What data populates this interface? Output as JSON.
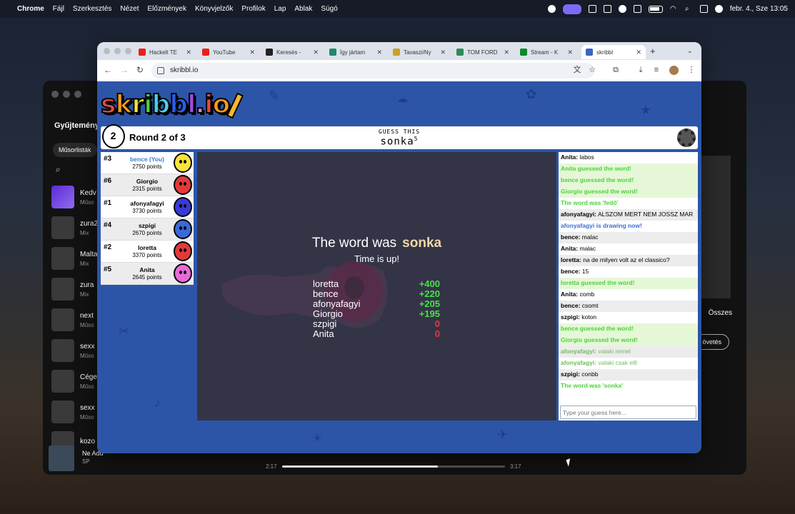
{
  "menubar": {
    "app": "Chrome",
    "items": [
      "Fájl",
      "Szerkesztés",
      "Nézet",
      "Előzmények",
      "Könyvjelzők",
      "Profilok",
      "Lap",
      "Ablak",
      "Súgó"
    ],
    "datetime": "febr. 4., Sze  13:05"
  },
  "spotify": {
    "section": "Gyűjtemény",
    "filter": "Műsorlisták",
    "rows": [
      {
        "title": "Kedv",
        "sub": "Műso"
      },
      {
        "title": "zura2",
        "sub": "Mix"
      },
      {
        "title": "Malta",
        "sub": "Mix"
      },
      {
        "title": "zura",
        "sub": "Mix"
      },
      {
        "title": "next",
        "sub": "Műso"
      },
      {
        "title": "sexx",
        "sub": "Műso"
      },
      {
        "title": "Céget",
        "sub": "Műso"
      },
      {
        "title": "sexx",
        "sub": "Műso"
      },
      {
        "title": "kozo",
        "sub": ""
      }
    ],
    "all_label": "Összes",
    "follow_label": "övetés",
    "player": {
      "song": "Ne Add",
      "artist": "SP",
      "elapsed": "2:17",
      "total": "3:17",
      "progress": 0.7
    }
  },
  "chrome": {
    "tabs": [
      {
        "label": "Hackelt TE",
        "color": "#e62117"
      },
      {
        "label": "YouTube",
        "color": "#e62117"
      },
      {
        "label": "Keresés -",
        "color": "#222"
      },
      {
        "label": "Így jártam",
        "color": "#1e8a6b"
      },
      {
        "label": "Tavaszi/Ny",
        "color": "#c9a227"
      },
      {
        "label": "TOM FORD",
        "color": "#2e8b57"
      },
      {
        "label": "Stream - K",
        "color": "#0b8a2a"
      },
      {
        "label": "skribbl",
        "color": "#3b63c4"
      }
    ],
    "url": "skribbl.io"
  },
  "game": {
    "logo": [
      "s",
      "k",
      "r",
      "i",
      "b",
      "b",
      "l",
      ".",
      "i",
      "o",
      ""
    ],
    "round_num": "2",
    "round_text": "Round 2 of 3",
    "guess_label": "GUESS THIS",
    "word": "sonka",
    "word_len": "5",
    "players": [
      {
        "rank": "#3",
        "name": "bence (You)",
        "points": "2750 points",
        "color": "#f5e43a",
        "you": true
      },
      {
        "rank": "#6",
        "name": "Giorgio",
        "points": "2315 points",
        "color": "#e23a3a",
        "you": false
      },
      {
        "rank": "#1",
        "name": "afonyafagyi",
        "points": "3730 points",
        "color": "#3a3ad8",
        "you": false
      },
      {
        "rank": "#4",
        "name": "szpigi",
        "points": "2670 points",
        "color": "#3a6ad8",
        "you": false
      },
      {
        "rank": "#2",
        "name": "loretta",
        "points": "3370 points",
        "color": "#e23a3a",
        "you": false
      },
      {
        "rank": "#5",
        "name": "Anita",
        "points": "2645 points",
        "color": "#e86ad8",
        "you": false
      }
    ],
    "reveal_prefix": "The word was",
    "reveal_word": "sonka",
    "time_up": "Time is up!",
    "results": [
      {
        "name": "loretta",
        "score": "+400"
      },
      {
        "name": "bence",
        "score": "+220"
      },
      {
        "name": "afonyafagyi",
        "score": "+205"
      },
      {
        "name": "Giorgio",
        "score": "+195"
      },
      {
        "name": "szpigi",
        "score": "0"
      },
      {
        "name": "Anita",
        "score": "0"
      }
    ],
    "chat": [
      {
        "who": "Anita:",
        "text": "labos",
        "type": "normal"
      },
      {
        "who": "",
        "text": "Anita guessed the word!",
        "type": "green"
      },
      {
        "who": "",
        "text": "bence guessed the word!",
        "type": "green"
      },
      {
        "who": "",
        "text": "Giorgio guessed the word!",
        "type": "green"
      },
      {
        "who": "",
        "text": "The word was 'fedő'",
        "type": "greenw"
      },
      {
        "who": "afonyafagyi:",
        "text": "ALSZOM MERT NEM JOSSZ MAR",
        "type": "normal"
      },
      {
        "who": "",
        "text": "afonyafagyi is drawing now!",
        "type": "blue"
      },
      {
        "who": "bence:",
        "text": "malac",
        "type": "normal"
      },
      {
        "who": "Anita:",
        "text": "malac",
        "type": "normal"
      },
      {
        "who": "loretta:",
        "text": "na de milyen volt az el classico?",
        "type": "normal"
      },
      {
        "who": "bence:",
        "text": "15",
        "type": "normal"
      },
      {
        "who": "",
        "text": "loretta guessed the word!",
        "type": "green"
      },
      {
        "who": "Anita:",
        "text": "comb",
        "type": "normal"
      },
      {
        "who": "bence:",
        "text": "csomt",
        "type": "normal"
      },
      {
        "who": "szpigi:",
        "text": "koton",
        "type": "normal"
      },
      {
        "who": "",
        "text": "bence guessed the word!",
        "type": "green"
      },
      {
        "who": "",
        "text": "Giorgio guessed the word!",
        "type": "green"
      },
      {
        "who": "afonyafagyi:",
        "text": "valaki remel",
        "type": "muted"
      },
      {
        "who": "afonyafagyi:",
        "text": "valaki csak elll",
        "type": "muted"
      },
      {
        "who": "szpigi:",
        "text": "conbb",
        "type": "normal"
      },
      {
        "who": "",
        "text": "The word was 'sonka'",
        "type": "greenw"
      }
    ],
    "chat_placeholder": "Type your guess here..."
  }
}
